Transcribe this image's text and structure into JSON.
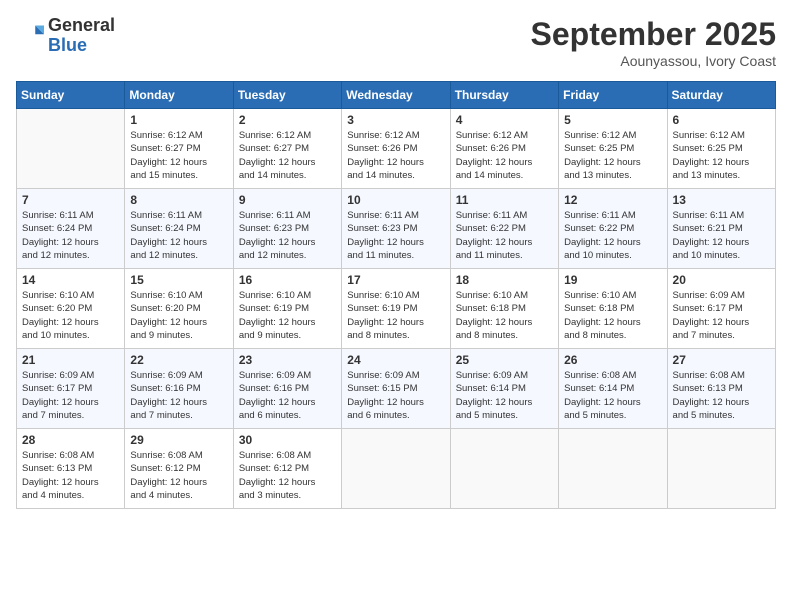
{
  "logo": {
    "general": "General",
    "blue": "Blue"
  },
  "header": {
    "title": "September 2025",
    "subtitle": "Aounyassou, Ivory Coast"
  },
  "weekdays": [
    "Sunday",
    "Monday",
    "Tuesday",
    "Wednesday",
    "Thursday",
    "Friday",
    "Saturday"
  ],
  "weeks": [
    [
      {
        "day": "",
        "info": ""
      },
      {
        "day": "1",
        "info": "Sunrise: 6:12 AM\nSunset: 6:27 PM\nDaylight: 12 hours\nand 15 minutes."
      },
      {
        "day": "2",
        "info": "Sunrise: 6:12 AM\nSunset: 6:27 PM\nDaylight: 12 hours\nand 14 minutes."
      },
      {
        "day": "3",
        "info": "Sunrise: 6:12 AM\nSunset: 6:26 PM\nDaylight: 12 hours\nand 14 minutes."
      },
      {
        "day": "4",
        "info": "Sunrise: 6:12 AM\nSunset: 6:26 PM\nDaylight: 12 hours\nand 14 minutes."
      },
      {
        "day": "5",
        "info": "Sunrise: 6:12 AM\nSunset: 6:25 PM\nDaylight: 12 hours\nand 13 minutes."
      },
      {
        "day": "6",
        "info": "Sunrise: 6:12 AM\nSunset: 6:25 PM\nDaylight: 12 hours\nand 13 minutes."
      }
    ],
    [
      {
        "day": "7",
        "info": "Sunrise: 6:11 AM\nSunset: 6:24 PM\nDaylight: 12 hours\nand 12 minutes."
      },
      {
        "day": "8",
        "info": "Sunrise: 6:11 AM\nSunset: 6:24 PM\nDaylight: 12 hours\nand 12 minutes."
      },
      {
        "day": "9",
        "info": "Sunrise: 6:11 AM\nSunset: 6:23 PM\nDaylight: 12 hours\nand 12 minutes."
      },
      {
        "day": "10",
        "info": "Sunrise: 6:11 AM\nSunset: 6:23 PM\nDaylight: 12 hours\nand 11 minutes."
      },
      {
        "day": "11",
        "info": "Sunrise: 6:11 AM\nSunset: 6:22 PM\nDaylight: 12 hours\nand 11 minutes."
      },
      {
        "day": "12",
        "info": "Sunrise: 6:11 AM\nSunset: 6:22 PM\nDaylight: 12 hours\nand 10 minutes."
      },
      {
        "day": "13",
        "info": "Sunrise: 6:11 AM\nSunset: 6:21 PM\nDaylight: 12 hours\nand 10 minutes."
      }
    ],
    [
      {
        "day": "14",
        "info": "Sunrise: 6:10 AM\nSunset: 6:20 PM\nDaylight: 12 hours\nand 10 minutes."
      },
      {
        "day": "15",
        "info": "Sunrise: 6:10 AM\nSunset: 6:20 PM\nDaylight: 12 hours\nand 9 minutes."
      },
      {
        "day": "16",
        "info": "Sunrise: 6:10 AM\nSunset: 6:19 PM\nDaylight: 12 hours\nand 9 minutes."
      },
      {
        "day": "17",
        "info": "Sunrise: 6:10 AM\nSunset: 6:19 PM\nDaylight: 12 hours\nand 8 minutes."
      },
      {
        "day": "18",
        "info": "Sunrise: 6:10 AM\nSunset: 6:18 PM\nDaylight: 12 hours\nand 8 minutes."
      },
      {
        "day": "19",
        "info": "Sunrise: 6:10 AM\nSunset: 6:18 PM\nDaylight: 12 hours\nand 8 minutes."
      },
      {
        "day": "20",
        "info": "Sunrise: 6:09 AM\nSunset: 6:17 PM\nDaylight: 12 hours\nand 7 minutes."
      }
    ],
    [
      {
        "day": "21",
        "info": "Sunrise: 6:09 AM\nSunset: 6:17 PM\nDaylight: 12 hours\nand 7 minutes."
      },
      {
        "day": "22",
        "info": "Sunrise: 6:09 AM\nSunset: 6:16 PM\nDaylight: 12 hours\nand 7 minutes."
      },
      {
        "day": "23",
        "info": "Sunrise: 6:09 AM\nSunset: 6:16 PM\nDaylight: 12 hours\nand 6 minutes."
      },
      {
        "day": "24",
        "info": "Sunrise: 6:09 AM\nSunset: 6:15 PM\nDaylight: 12 hours\nand 6 minutes."
      },
      {
        "day": "25",
        "info": "Sunrise: 6:09 AM\nSunset: 6:14 PM\nDaylight: 12 hours\nand 5 minutes."
      },
      {
        "day": "26",
        "info": "Sunrise: 6:08 AM\nSunset: 6:14 PM\nDaylight: 12 hours\nand 5 minutes."
      },
      {
        "day": "27",
        "info": "Sunrise: 6:08 AM\nSunset: 6:13 PM\nDaylight: 12 hours\nand 5 minutes."
      }
    ],
    [
      {
        "day": "28",
        "info": "Sunrise: 6:08 AM\nSunset: 6:13 PM\nDaylight: 12 hours\nand 4 minutes."
      },
      {
        "day": "29",
        "info": "Sunrise: 6:08 AM\nSunset: 6:12 PM\nDaylight: 12 hours\nand 4 minutes."
      },
      {
        "day": "30",
        "info": "Sunrise: 6:08 AM\nSunset: 6:12 PM\nDaylight: 12 hours\nand 3 minutes."
      },
      {
        "day": "",
        "info": ""
      },
      {
        "day": "",
        "info": ""
      },
      {
        "day": "",
        "info": ""
      },
      {
        "day": "",
        "info": ""
      }
    ]
  ]
}
